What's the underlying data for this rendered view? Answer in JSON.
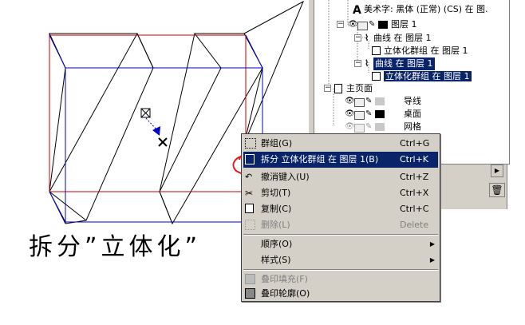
{
  "caption": "拆分”立体化”",
  "tree": {
    "items": [
      {
        "label": "美术字: 黑体 (正常) (CS) 在 图."
      },
      {
        "label": "图层 1"
      },
      {
        "label": "曲线 在 图层 1"
      },
      {
        "label": "立体化群组 在 图层 1"
      },
      {
        "label": "曲线 在 图层 1"
      },
      {
        "label": "立体化群组 在 图层 1"
      },
      {
        "label": "主页面"
      },
      {
        "label": "导线"
      },
      {
        "label": "桌面"
      },
      {
        "label": "网格"
      }
    ]
  },
  "menu": {
    "items": [
      {
        "label": "群组(G)",
        "shortcut": "Ctrl+G"
      },
      {
        "label": "拆分 立体化群组 在 图层 1(B)",
        "shortcut": "Ctrl+K"
      },
      {
        "label": "撤消键入(U)",
        "shortcut": "Ctrl+Z"
      },
      {
        "label": "剪切(T)",
        "shortcut": "Ctrl+X"
      },
      {
        "label": "复制(C)",
        "shortcut": "Ctrl+C"
      },
      {
        "label": "删除(L)",
        "shortcut": "Delete"
      },
      {
        "label": "顺序(O)"
      },
      {
        "label": "样式(S)"
      },
      {
        "label": "叠印填充(F)"
      },
      {
        "label": "叠印轮廓(O)"
      }
    ]
  },
  "colors": {
    "highlight": "#0a246a",
    "menu_bg": "#d4d0c8",
    "annotation": "#e8161a",
    "bbox_red": "#cc0000",
    "bbox_blue": "#0000cc"
  }
}
